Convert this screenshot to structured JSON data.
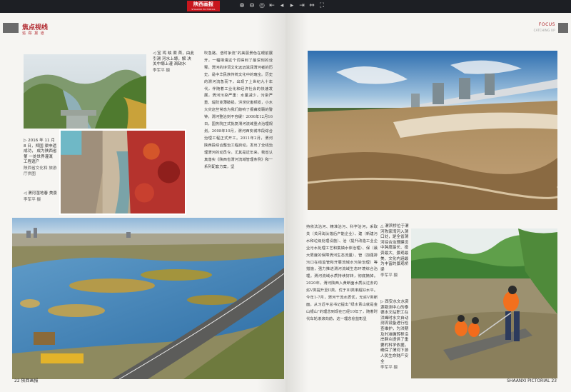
{
  "toolbar": {
    "logo_main": "陕西画报",
    "logo_sub": "SHAANXI PICTORIAL",
    "tools": [
      "zoom-in",
      "zoom-out",
      "zoom-reset",
      "first-page",
      "previous-page",
      "next-page",
      "last-page",
      "fit-width",
      "fullscreen"
    ],
    "glyphs": [
      "⊕",
      "⊖",
      "◎",
      "⇤",
      "◂",
      "▸",
      "⇥",
      "⇔",
      "⛶"
    ]
  },
  "left_page": {
    "section_title": "焦点视线",
    "section_sub": "追 踪 报 道",
    "caption_dam": "◁ 宝 鸡 峡 渠 首，由此引渭 河水上塬，解 决关中塬上灌 溉缺水",
    "caption_dam_by": "李军平 摄",
    "caption_heritage": "▷ 2016 年 11 月 8 日，郑国 渠申遗成功， 成为陕西省第 一处世界灌溉 工程遗产",
    "caption_heritage_by": "陕西省文化和 旅游厅供图",
    "caption_spring": "◁ 渭河湿地春 美景",
    "caption_spring_by": "李军平 摄",
    "body": "吹急路、浩时争流”的美丽景色在眼前展开，一幅相濡这个词得到了最深刻的诠释。渭河的诗词文化远远滋润渭河者的历史，是中华民族传统文化中的瑰宝。历史的渭河流急而下，出现了上世纪九十年代，伴随着工业化和经济社会的快速发展，渭河污染严重：水量减少，污染严重、堤防变薄破损，洪涝灾害频发，小水大灾这些常态为我们敲响了振聋发聩的警钟。渭河整治刻不容缓！2006年12月16日，国务院正式批复渭河流域重点治理规划。2008年10月，渭河西安城市段综合治理工程正式开工。2011年2月，渭河陕西段综合整治工程启动，发出了全线治理渭河的动员令。尤其是近年来，我省认真落实《陕西省渭河流域管理条例》和一系列配套方案，坚",
    "folio": "22 陕西画报"
  },
  "right_page": {
    "focus_title": "FOCUS",
    "focus_sub": "CATCHING UP",
    "caption_bridge": "△ 渭滨桥位于渭河陈家湾河入渭口处，是全省渭河综合治理建设中跨度最长、投资最大、景观最美、文化内涵最为丰富的景观桥梁",
    "caption_bridge_by": "李军平 摄",
    "caption_monitor": "▷ 西安水文水资源勘测中心的泰德水文站职工在洪峰时水文自动测流设备进行检查维护，为洪期及时准确转移沿岸群众提供了重要的科学依据，确保了渭河下游人民生命财产安全",
    "caption_monitor_by": "李军平 摄",
    "body": "持依法治河、精准治污、科学治河，采取关（关闭淘汰落后产能企业）、建（新建污水和垃圾处理设施）、治（提升改造工业企业污水处理工艺和集镇水体治理）、保（最大限度的保障渭河生态流量）、管（加强排污口在线监管和开展流域水污染治理）等措施，强力推进渭河流域生态环境综合治理。渭河流域水质持续好转，彻底摘掉。2020年，渭河陕西入黄断面水质从过去的劣V类提升至II类，优于III类率超好水平。今年1-7月，渭河干流水质优，无劣V类断面。从习近平总书记提出“绿水青山就是金山银山”的理念到现在已经10年了，随着时代车轮滚滚向前，这一理念愈益彰显",
    "folio": "SHAANXI PICTORIAL 23"
  },
  "colors": {
    "accent": "#b0262c",
    "toolbar_bg": "#1d1f24",
    "logo_bg": "#c8161d"
  }
}
